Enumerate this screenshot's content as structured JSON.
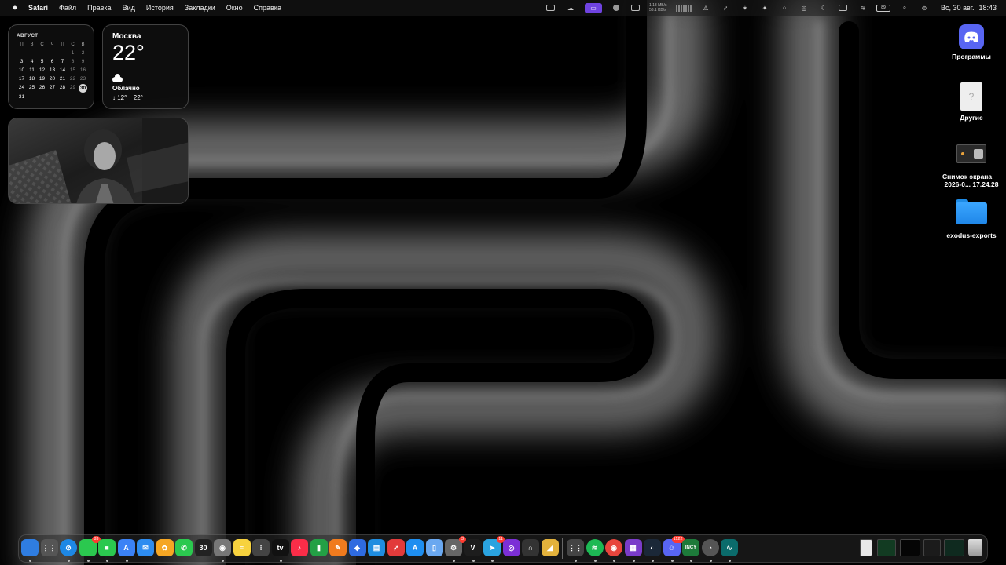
{
  "menubar": {
    "apple_icon": "apple-logo-icon",
    "app_name": "Safari",
    "items": [
      "Файл",
      "Правка",
      "Вид",
      "История",
      "Закладки",
      "Окно",
      "Справка"
    ],
    "net_up": "1.18 MB/s",
    "net_down": "53.1 KB/s",
    "battery": "89",
    "date": "Вс, 30 авг.",
    "time": "18:43",
    "accent_color": "#6f43e0"
  },
  "calendar": {
    "month": "АВГУСТ",
    "weekdays": [
      "П",
      "В",
      "С",
      "Ч",
      "П",
      "С",
      "В"
    ],
    "weeks": [
      [
        "",
        "",
        "",
        "",
        "",
        "1",
        "2"
      ],
      [
        "3",
        "4",
        "5",
        "6",
        "7",
        "8",
        "9"
      ],
      [
        "10",
        "11",
        "12",
        "13",
        "14",
        "15",
        "16"
      ],
      [
        "17",
        "18",
        "19",
        "20",
        "21",
        "22",
        "23"
      ],
      [
        "24",
        "25",
        "26",
        "27",
        "28",
        "29",
        "30"
      ],
      [
        "31",
        "",
        "",
        "",
        "",
        "",
        ""
      ]
    ],
    "today": "30"
  },
  "weather": {
    "city": "Москва",
    "temp": "22°",
    "condition": "Облачно",
    "range": "↓ 12° ↑ 22°"
  },
  "desktop": {
    "icons": [
      {
        "label": "Программы",
        "icon": "discord-icon"
      },
      {
        "label": "Другие",
        "icon": "document-icon"
      },
      {
        "label_line1": "Снимок экрана —",
        "label_line2": "2026-0... 17.24.28",
        "icon": "screenshot-thumbnail"
      },
      {
        "label": "exodus-exports",
        "icon": "folder-icon"
      }
    ]
  },
  "dock": {
    "apps": [
      {
        "name": "finder",
        "color": "#2f7de1",
        "text": ""
      },
      {
        "name": "launchpad",
        "color": "#555",
        "text": "⋮⋮"
      },
      {
        "name": "safari",
        "color": "#1e88e5",
        "text": "⊘",
        "round": true
      },
      {
        "name": "messages",
        "color": "#2bc84f",
        "text": "",
        "badge": "83"
      },
      {
        "name": "facetime",
        "color": "#2bc84f",
        "text": "■"
      },
      {
        "name": "instruments",
        "color": "#3b82f6",
        "text": "A"
      },
      {
        "name": "mail",
        "color": "#2d8cf0",
        "text": "✉"
      },
      {
        "name": "photos",
        "color": "#f5a623",
        "text": "✿"
      },
      {
        "name": "phone",
        "color": "#2bc84f",
        "text": "✆"
      },
      {
        "name": "calendar",
        "color": "#222",
        "text": "30"
      },
      {
        "name": "contacts",
        "color": "#777",
        "text": "◉"
      },
      {
        "name": "notes",
        "color": "#f7d23e",
        "text": "≡"
      },
      {
        "name": "reminders",
        "color": "#444",
        "text": "⁝"
      },
      {
        "name": "apple-tv",
        "color": "#111",
        "text": "tv"
      },
      {
        "name": "music",
        "color": "#fa2d48",
        "text": "♪"
      },
      {
        "name": "numbers",
        "color": "#23a045",
        "text": "▮"
      },
      {
        "name": "pages",
        "color": "#f07b1e",
        "text": "✎"
      },
      {
        "name": "keynote",
        "color": "#2f6be0",
        "text": "◆"
      },
      {
        "name": "keynote-remote",
        "color": "#1f8de0",
        "text": "▤"
      },
      {
        "name": "rocket-typist",
        "color": "#e23b3b",
        "text": "➶"
      },
      {
        "name": "app-store",
        "color": "#1e8ef0",
        "text": "A"
      },
      {
        "name": "preview",
        "color": "#6aa8f0",
        "text": "▯"
      },
      {
        "name": "system-settings",
        "color": "#666",
        "text": "⚙",
        "badge": "3"
      },
      {
        "name": "vim",
        "color": "#1d1d1d",
        "text": "V"
      },
      {
        "name": "telegram",
        "color": "#2aa3e0",
        "text": "➤",
        "badge": "11"
      },
      {
        "name": "tor-browser",
        "color": "#7b2fd6",
        "text": "◎"
      },
      {
        "name": "utility-app",
        "color": "#333",
        "text": "∩"
      },
      {
        "name": "yellow-app",
        "color": "#e3b23c",
        "text": "◢"
      },
      {
        "name": "launchpad-grid",
        "color": "#444",
        "text": "⋮⋮"
      },
      {
        "name": "spotify",
        "color": "#1db954",
        "text": "≋",
        "round": true
      },
      {
        "name": "chrome",
        "color": "#e8453c",
        "text": "◉",
        "round": true
      },
      {
        "name": "activity-grid",
        "color": "#7a3cc9",
        "text": "▦"
      },
      {
        "name": "steam",
        "color": "#1b2838",
        "text": "◐"
      },
      {
        "name": "discord",
        "color": "#5865f2",
        "text": "☺",
        "badge": "1122"
      },
      {
        "name": "incy",
        "color": "#1d7a3a",
        "text": "INCY"
      },
      {
        "name": "stats-app",
        "color": "#555",
        "text": "◔",
        "round": true
      },
      {
        "name": "waveform-app",
        "color": "#0b6b6b",
        "text": "∿"
      }
    ],
    "windows": [
      "window-thumbnail-1",
      "window-thumbnail-2",
      "window-thumbnail-3",
      "window-thumbnail-4",
      "window-thumbnail-5"
    ],
    "trash": "trash-icon"
  }
}
